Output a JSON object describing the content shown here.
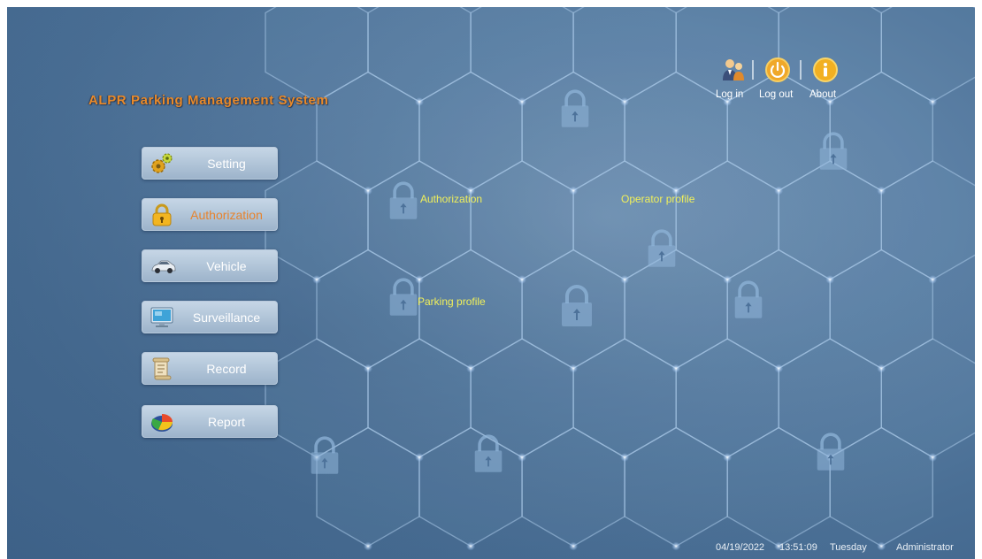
{
  "app": {
    "title": "ALPR Parking Management System"
  },
  "menu": {
    "items": [
      {
        "label": "Setting",
        "icon": "gears-icon"
      },
      {
        "label": "Authorization",
        "icon": "padlock-icon",
        "active": true
      },
      {
        "label": "Vehicle",
        "icon": "car-icon"
      },
      {
        "label": "Surveillance",
        "icon": "monitor-icon"
      },
      {
        "label": "Record",
        "icon": "scroll-icon"
      },
      {
        "label": "Report",
        "icon": "pie-chart-icon"
      }
    ]
  },
  "tiles": {
    "authorization": "Authorization",
    "operator_profile": "Operator profile",
    "parking_profile": "Parking profile"
  },
  "header": {
    "login": "Log in",
    "logout": "Log out",
    "about": "About"
  },
  "status": {
    "date": "04/19/2022",
    "time": "13:51:09",
    "weekday": "Tuesday",
    "user": "Administrator"
  },
  "colors": {
    "accent": "#e98a2a",
    "tile_label": "#f1f05a",
    "background": "#5f83a8"
  }
}
